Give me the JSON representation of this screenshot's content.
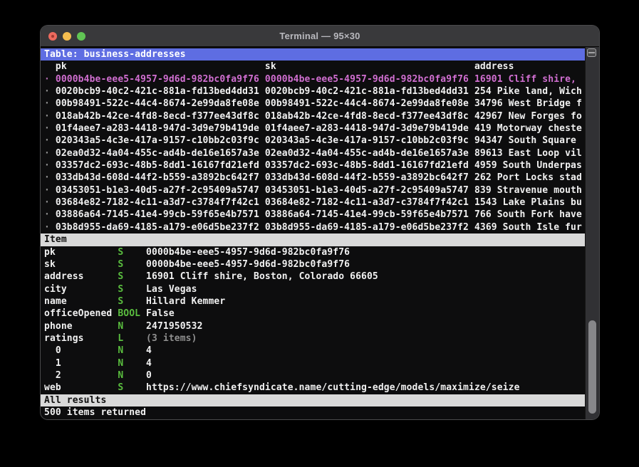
{
  "window": {
    "title": "Terminal — 95×30"
  },
  "table_view": {
    "header": "Table: business-addresses",
    "columns": [
      "pk",
      "sk",
      "address"
    ],
    "rows": [
      {
        "pk": "0000b4be-eee5-4957-9d6d-982bc0fa9f76",
        "sk": "0000b4be-eee5-4957-9d6d-982bc0fa9f76",
        "address": "16901 Cliff shire,",
        "selected": true
      },
      {
        "pk": "0020bcb9-40c2-421c-881a-fd13bed4dd31",
        "sk": "0020bcb9-40c2-421c-881a-fd13bed4dd31",
        "address": "254 Pike land, Wich",
        "selected": false
      },
      {
        "pk": "00b98491-522c-44c4-8674-2e99da8fe08e",
        "sk": "00b98491-522c-44c4-8674-2e99da8fe08e",
        "address": "34796 West Bridge f",
        "selected": false
      },
      {
        "pk": "018ab42b-42ce-4fd8-8ecd-f377ee43df8c",
        "sk": "018ab42b-42ce-4fd8-8ecd-f377ee43df8c",
        "address": "42967 New Forges fo",
        "selected": false
      },
      {
        "pk": "01f4aee7-a283-4418-947d-3d9e79b419de",
        "sk": "01f4aee7-a283-4418-947d-3d9e79b419de",
        "address": "419 Motorway cheste",
        "selected": false
      },
      {
        "pk": "020343a5-4c3e-417a-9157-c10bb2c03f9c",
        "sk": "020343a5-4c3e-417a-9157-c10bb2c03f9c",
        "address": "94347 South Square",
        "selected": false
      },
      {
        "pk": "02ea0d32-4a04-455c-ad4b-de16e1657a3e",
        "sk": "02ea0d32-4a04-455c-ad4b-de16e1657a3e",
        "address": "89613 East Loop vil",
        "selected": false
      },
      {
        "pk": "03357dc2-693c-48b5-8dd1-16167fd21efd",
        "sk": "03357dc2-693c-48b5-8dd1-16167fd21efd",
        "address": "4959 South Underpas",
        "selected": false
      },
      {
        "pk": "033db43d-608d-44f2-b559-a3892bc642f7",
        "sk": "033db43d-608d-44f2-b559-a3892bc642f7",
        "address": "262 Port Locks stad",
        "selected": false
      },
      {
        "pk": "03453051-b1e3-40d5-a27f-2c95409a5747",
        "sk": "03453051-b1e3-40d5-a27f-2c95409a5747",
        "address": "839 Stravenue mouth",
        "selected": false
      },
      {
        "pk": "03684e82-7182-4c11-a3d7-c3784f7f42c1",
        "sk": "03684e82-7182-4c11-a3d7-c3784f7f42c1",
        "address": "1543 Lake Plains bu",
        "selected": false
      },
      {
        "pk": "03886a64-7145-41e4-99cb-59f65e4b7571",
        "sk": "03886a64-7145-41e4-99cb-59f65e4b7571",
        "address": "766 South Fork have",
        "selected": false
      },
      {
        "pk": "03b8d955-da69-4185-a179-e06d5be237f2",
        "sk": "03b8d955-da69-4185-a179-e06d5be237f2",
        "address": "4369 South Isle fur",
        "selected": false
      }
    ]
  },
  "item_view": {
    "header": "Item",
    "fields": [
      {
        "key": "pk",
        "type": "S",
        "value": "0000b4be-eee5-4957-9d6d-982bc0fa9f76",
        "indent": 0,
        "muted": false
      },
      {
        "key": "sk",
        "type": "S",
        "value": "0000b4be-eee5-4957-9d6d-982bc0fa9f76",
        "indent": 0,
        "muted": false
      },
      {
        "key": "address",
        "type": "S",
        "value": "16901 Cliff shire, Boston, Colorado 66605",
        "indent": 0,
        "muted": false
      },
      {
        "key": "city",
        "type": "S",
        "value": "Las Vegas",
        "indent": 0,
        "muted": false
      },
      {
        "key": "name",
        "type": "S",
        "value": "Hillard Kemmer",
        "indent": 0,
        "muted": false
      },
      {
        "key": "officeOpened",
        "type": "BOOL",
        "value": "False",
        "indent": 0,
        "muted": false
      },
      {
        "key": "phone",
        "type": "N",
        "value": "2471950532",
        "indent": 0,
        "muted": false
      },
      {
        "key": "ratings",
        "type": "L",
        "value": "(3 items)",
        "indent": 0,
        "muted": true
      },
      {
        "key": "0",
        "type": "N",
        "value": "4",
        "indent": 2,
        "muted": false
      },
      {
        "key": "1",
        "type": "N",
        "value": "4",
        "indent": 2,
        "muted": false
      },
      {
        "key": "2",
        "type": "N",
        "value": "0",
        "indent": 2,
        "muted": false
      },
      {
        "key": "web",
        "type": "S",
        "value": "https://www.chiefsyndicate.name/cutting-edge/models/maximize/seize",
        "indent": 0,
        "muted": false
      }
    ]
  },
  "status": {
    "results_bar": "All results",
    "items_line": "500 items returned"
  },
  "colors": {
    "accent_blue": "#5e6de2",
    "selected_pink": "#d16fd1",
    "type_green": "#5abe3f",
    "muted_gray": "#8f8f8f",
    "bar_bg": "#d9d9d9"
  }
}
